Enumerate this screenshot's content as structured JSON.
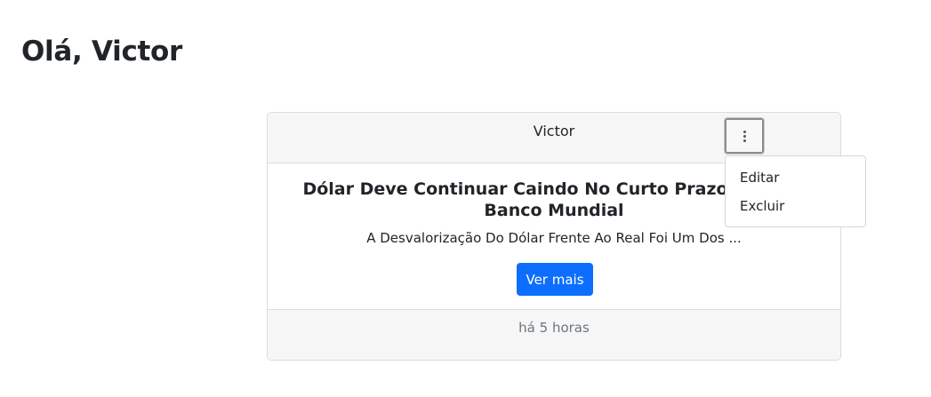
{
  "greeting": "Olá, Victor",
  "post": {
    "author": "Victor",
    "title_line1": "Dólar Deve Continuar Caindo No Curto Prazo, Diz Ex-",
    "title_line2": "Banco Mundial",
    "excerpt": "A Desvalorização Do Dólar Frente Ao Real Foi Um Dos ...",
    "more_label": "Ver mais",
    "time": "há 5 horas"
  },
  "menu": {
    "items": [
      "Editar",
      "Excluir"
    ]
  },
  "colors": {
    "primary": "#0d6efd",
    "muted": "#6c757d",
    "header_bg": "#f6f6f6"
  },
  "icons": {
    "menu_toggle": "kebab-vertical-icon"
  }
}
